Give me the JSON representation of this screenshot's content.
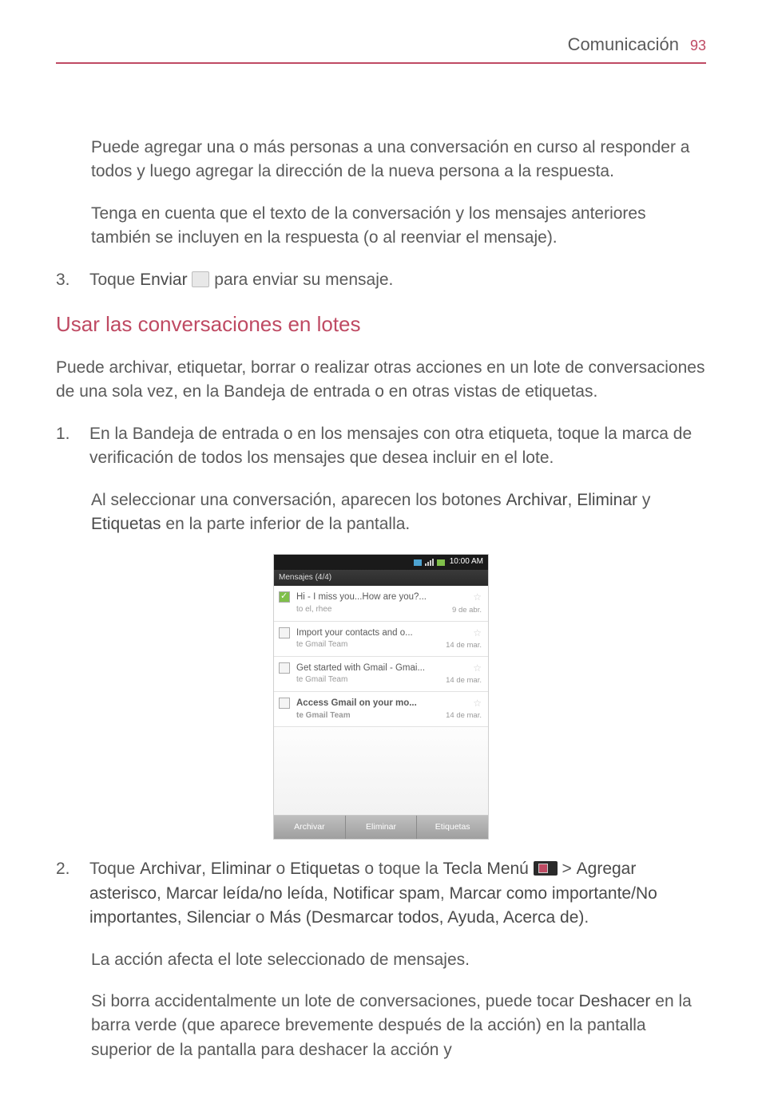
{
  "header": {
    "section": "Comunicación",
    "page": "93"
  },
  "p1": "Puede agregar una o más personas a una conversación en curso al responder a todos y luego agregar la dirección de la nueva persona a la respuesta.",
  "p2": "Tenga en cuenta que el texto de la conversación y los mensajes anteriores también se incluyen en la respuesta (o al reenviar el mensaje).",
  "step3": {
    "num": "3.",
    "a": "Toque ",
    "b": "Enviar",
    "c": " para enviar su mensaje."
  },
  "h2": "Usar las conversaciones en lotes",
  "p3": "Puede archivar, etiquetar, borrar o realizar otras acciones en un lote de conversaciones de una sola vez, en la Bandeja de entrada o en otras vistas de etiquetas.",
  "s1": {
    "num": "1.",
    "t": "En la Bandeja de entrada o en los mensajes con otra etiqueta, toque la marca de verificación de todos los mensajes que desea incluir en el lote."
  },
  "s1b": {
    "a": "Al seleccionar una conversación, aparecen los botones ",
    "b": "Archivar",
    "c": ", ",
    "d": "Eliminar",
    "e": " y ",
    "f": "Etiquetas",
    "g": " en la parte inferior de la pantalla."
  },
  "shot": {
    "time": "10:00 AM",
    "title_left": "Mensajes (4/4)",
    "title_right": "",
    "rows": [
      {
        "subj": "Hi - I miss you...How are you?...",
        "from": "to el, rhee",
        "date": "9 de abr."
      },
      {
        "subj": "Import your contacts and o...",
        "from": "te Gmail Team",
        "date": "14 de mar."
      },
      {
        "subj": "Get started with Gmail - Gmai...",
        "from": "te Gmail Team",
        "date": "14 de mar."
      },
      {
        "subj": "Access Gmail on your mo...",
        "from": "te Gmail Team",
        "date": "14 de mar."
      }
    ],
    "buttons": [
      "Archivar",
      "Eliminar",
      "Etiquetas"
    ]
  },
  "s2": {
    "num": "2.",
    "a": "Toque ",
    "b": "Archivar",
    "c": ", ",
    "d": "Eliminar",
    "e": " o ",
    "f": "Etiquetas",
    "g": " o toque la ",
    "h": "Tecla Menú",
    "i": " ",
    "j": " > ",
    "k": "Agregar asterisco",
    "l": ", ",
    "m": "Marcar leída/no leída",
    "n": ", ",
    "o": "Notificar spam",
    "p": ", ",
    "q": "Marcar como importante/No importantes, Silenciar",
    "r": " o ",
    "s": "Más (Desmarcar todos, Ayuda, Acerca de)",
    "t": "."
  },
  "s2b": "La acción afecta el lote seleccionado de mensajes.",
  "s2c": {
    "a": "Si borra accidentalmente un lote de conversaciones, puede tocar ",
    "b": "Deshacer",
    "c": " en la barra verde (que aparece brevemente después de la acción) en la pantalla superior de la pantalla para deshacer la acción y"
  }
}
